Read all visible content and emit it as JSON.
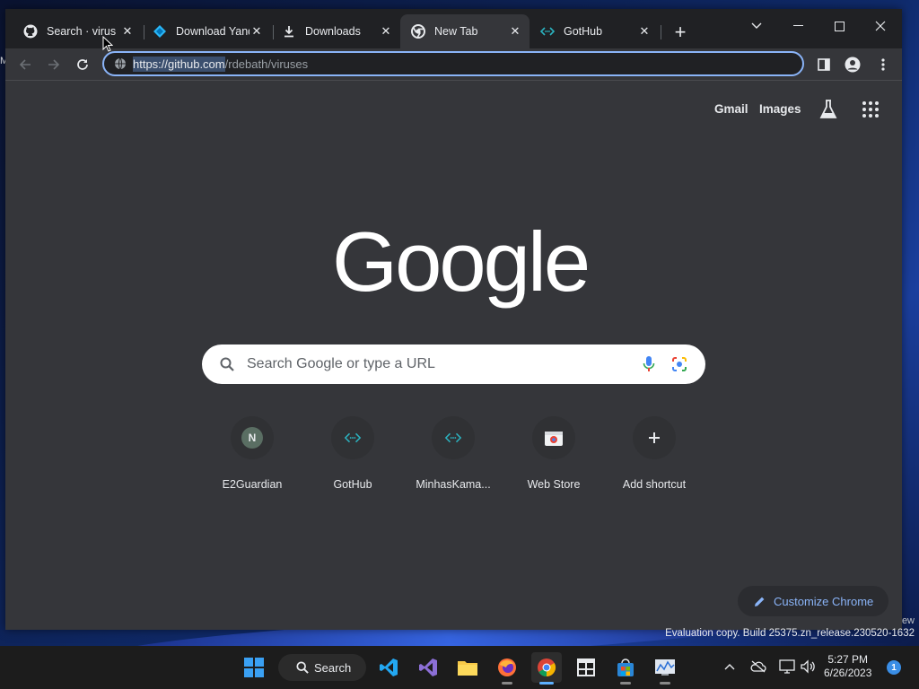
{
  "browser": {
    "tabs": [
      {
        "title": "Search · virus · GitHub",
        "icon": "github-icon",
        "active": false
      },
      {
        "title": "Download Yandex",
        "icon": "yandex-icon",
        "active": false
      },
      {
        "title": "Downloads",
        "icon": "download-icon",
        "active": false
      },
      {
        "title": "New Tab",
        "icon": "chrome-icon",
        "active": true
      },
      {
        "title": "GotHub",
        "icon": "gothub-icon",
        "active": false
      }
    ],
    "address_bar": {
      "host": "https://github.com",
      "path": "/rdebath/viruses"
    },
    "accent_color": "#8ab4f8"
  },
  "ntp": {
    "links": {
      "gmail": "Gmail",
      "images": "Images"
    },
    "logo": "Google",
    "search_placeholder": "Search Google or type a URL",
    "shortcuts": [
      {
        "label": "E2Guardian",
        "letter": "N"
      },
      {
        "label": "GotHub"
      },
      {
        "label": "MinhasKama..."
      },
      {
        "label": "Web Store"
      },
      {
        "label": "Add shortcut"
      }
    ],
    "customize_label": "Customize Chrome"
  },
  "desktop": {
    "watermark_top": "ew",
    "watermark": "Evaluation copy. Build 25375.zn_release.230520-1632",
    "left_fragment": "M"
  },
  "taskbar": {
    "search_label": "Search",
    "time": "5:27 PM",
    "date": "6/26/2023",
    "notification_count": "1"
  }
}
